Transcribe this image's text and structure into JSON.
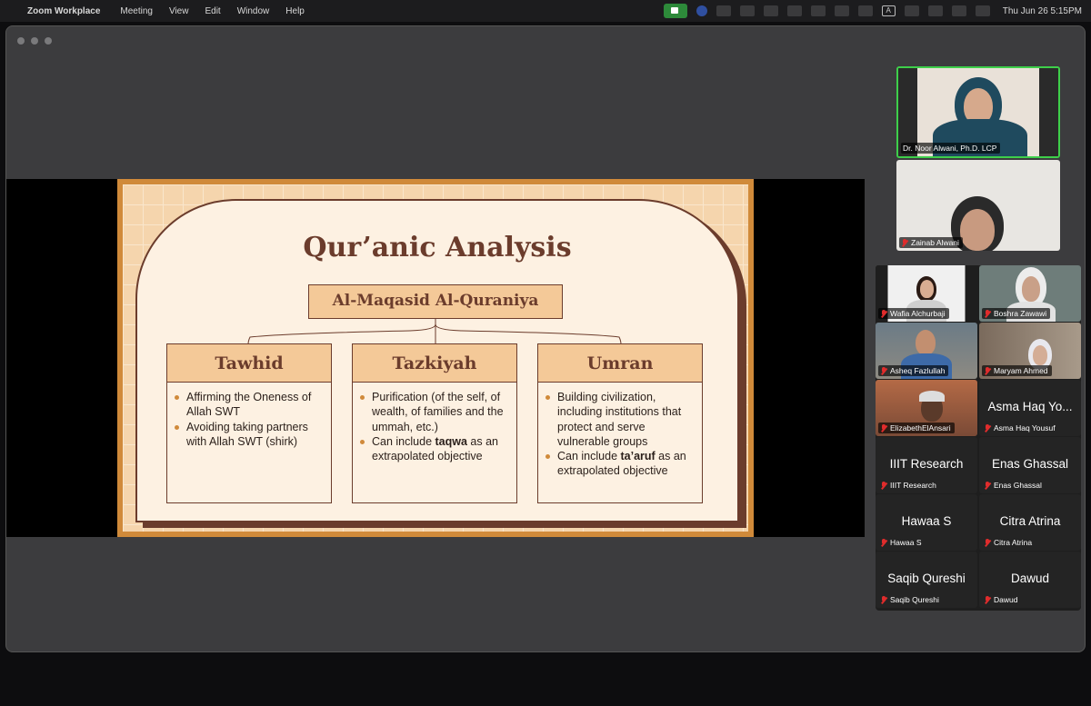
{
  "menubar": {
    "app_name": "Zoom Workplace",
    "menus": [
      "Meeting",
      "View",
      "Edit",
      "Window",
      "Help"
    ],
    "clock": "Thu Jun 26  5:15PM",
    "status_icons": [
      "zoom-video-icon",
      "circle-icon",
      "extension-icon",
      "sync-icon",
      "cloud-icon",
      "cloud-icon",
      "cloud-icon",
      "screenshot-icon",
      "keyboard-icon",
      "input-source-icon",
      "battery-icon",
      "wifi-icon",
      "search-icon",
      "control-center-icon"
    ],
    "input_source": "A"
  },
  "slide": {
    "title": "Qur’anic Analysis",
    "root": "Al-Maqasid Al-Quraniya",
    "columns": [
      {
        "heading": "Tawhid",
        "bullets": [
          {
            "text": "Affirming the Oneness of Allah SWT"
          },
          {
            "text": "Avoiding taking partners with Allah SWT (shirk)"
          }
        ]
      },
      {
        "heading": "Tazkiyah",
        "bullets": [
          {
            "text": "Purification (of the self, of wealth, of families and the ummah, etc.)"
          },
          {
            "pre": "Can include ",
            "bold": "taqwa",
            "post": " as an extrapolated objective"
          }
        ]
      },
      {
        "heading": "Umran",
        "bullets": [
          {
            "text": "Building civilization, including institutions that protect and serve vulnerable groups"
          },
          {
            "pre": "Can include ",
            "bold": "ta’aruf",
            "post": " as an extrapolated objective"
          }
        ]
      }
    ]
  },
  "speaker_tiles": [
    {
      "name": "Dr. Noor Alwani, Ph.D. LCP"
    },
    {
      "name": "Zainab Alwani"
    }
  ],
  "gallery": [
    {
      "name": "Wafia Alchurbaji",
      "display": ""
    },
    {
      "name": "Boshra Zawawi",
      "display": ""
    },
    {
      "name": "Asheq Fazlullah",
      "display": ""
    },
    {
      "name": "Maryam Ahmed",
      "display": ""
    },
    {
      "name": "ElizabethElAnsari",
      "display": ""
    },
    {
      "name": "Asma Haq Yousuf",
      "display": "Asma Haq Yo..."
    },
    {
      "name": "IIIT Research",
      "display": "IIIT Research"
    },
    {
      "name": "Enas Ghassal",
      "display": "Enas Ghassal"
    },
    {
      "name": "Hawaa S",
      "display": "Hawaa S"
    },
    {
      "name": "Citra Atrina",
      "display": "Citra Atrina"
    },
    {
      "name": "Saqib Qureshi",
      "display": "Saqib Qureshi"
    },
    {
      "name": "Dawud",
      "display": "Dawud"
    }
  ]
}
